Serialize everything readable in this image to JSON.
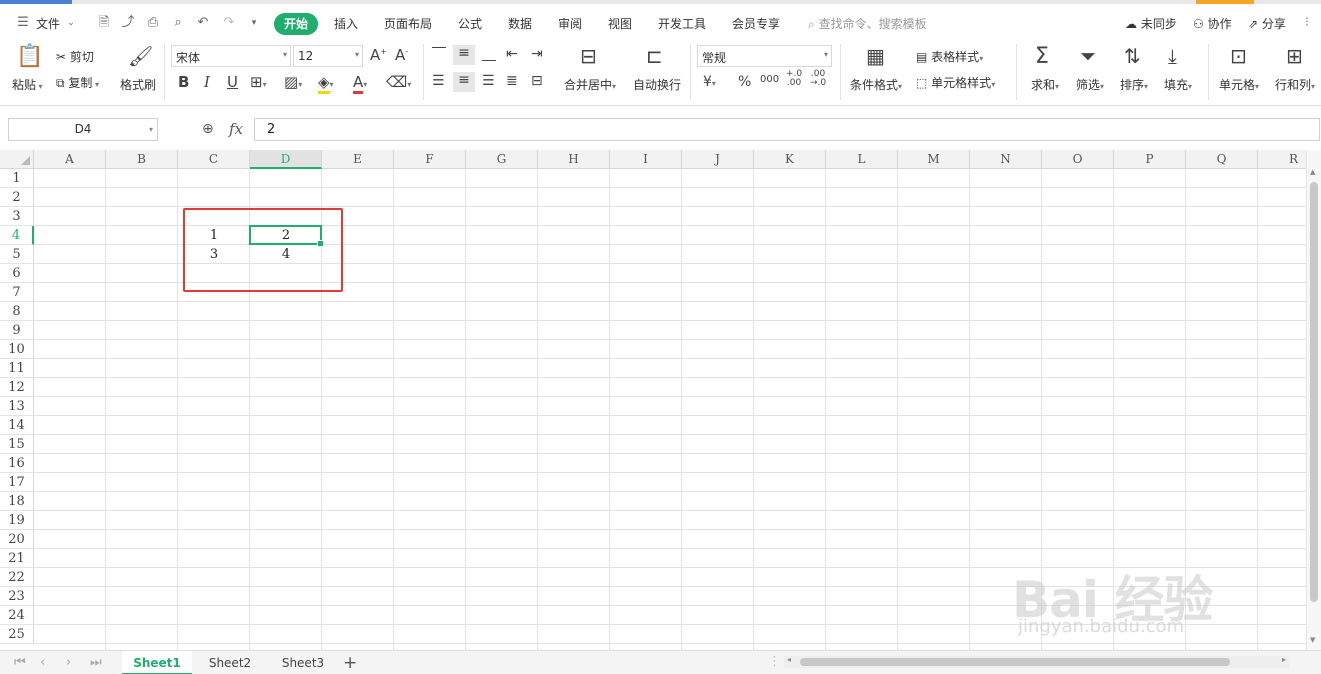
{
  "menubar": {
    "file_label": "文件",
    "tabs": [
      "开始",
      "插入",
      "页面布局",
      "公式",
      "数据",
      "审阅",
      "视图",
      "开发工具",
      "会员专享"
    ],
    "search_placeholder": "查找命令、搜索模板",
    "sync_label": "未同步",
    "collab_label": "协作",
    "share_label": "分享"
  },
  "ribbon": {
    "paste": "粘贴",
    "cut": "剪切",
    "copy": "复制",
    "format_painter": "格式刷",
    "font_name": "宋体",
    "font_size": "12",
    "bold": "B",
    "italic": "I",
    "underline": "U",
    "merge_center": "合并居中",
    "wrap_text": "自动换行",
    "number_format": "常规",
    "currency": "¥",
    "percent": "%",
    "thousands": "000",
    "dec_increase": "+.0\n.00",
    "dec_decrease": ".00\n→.0",
    "conditional_format": "条件格式",
    "table_style": "表格样式",
    "cell_style": "单元格样式",
    "sum": "求和",
    "filter": "筛选",
    "sort": "排序",
    "fill": "填充",
    "cell": "单元格",
    "rows_cols": "行和列"
  },
  "formula_bar": {
    "name_box": "D4",
    "fx_label": "fx",
    "value": "2"
  },
  "grid": {
    "columns": [
      "A",
      "B",
      "C",
      "D",
      "E",
      "F",
      "G",
      "H",
      "I",
      "J",
      "K",
      "L",
      "M",
      "N",
      "O",
      "P",
      "Q",
      "R"
    ],
    "rows": [
      "1",
      "2",
      "3",
      "4",
      "5",
      "6",
      "7",
      "8",
      "9",
      "10",
      "11",
      "12",
      "13",
      "14",
      "15",
      "16",
      "17",
      "18",
      "19",
      "20",
      "21",
      "22",
      "23",
      "24",
      "25"
    ],
    "selected_cell": "D4",
    "cells": {
      "C4": "1",
      "D4": "2",
      "C5": "3",
      "D5": "4"
    }
  },
  "sheets": {
    "tabs": [
      "Sheet1",
      "Sheet2",
      "Sheet3"
    ],
    "active": "Sheet1"
  },
  "watermark": {
    "logo_text": "Bai 经验",
    "url": "jingyan.baidu.com"
  },
  "colors": {
    "accent": "#1fae6c",
    "highlight_box": "#e53935"
  }
}
